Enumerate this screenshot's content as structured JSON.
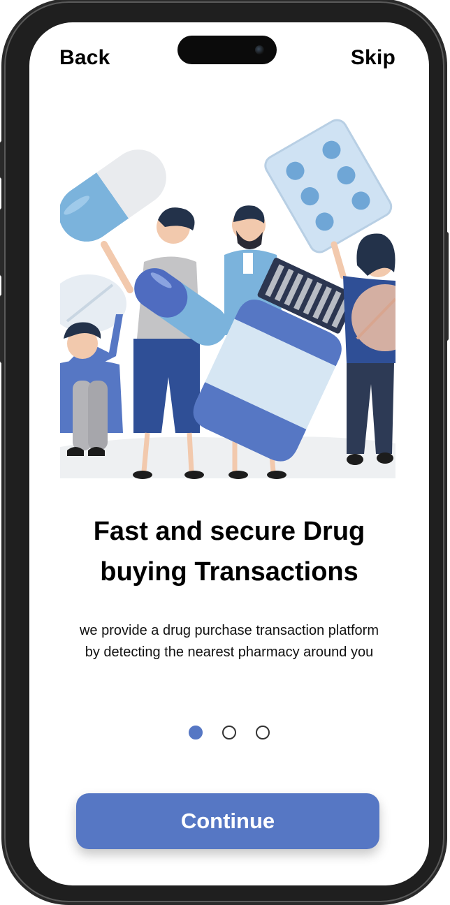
{
  "nav": {
    "back_label": "Back",
    "skip_label": "Skip"
  },
  "onboarding": {
    "title_line1": "Fast and secure Drug",
    "title_line2": "buying Transactions",
    "description": "we provide a drug purchase transaction platform by detecting the nearest pharmacy around you",
    "page_count": 3,
    "active_page": 1
  },
  "cta": {
    "label": "Continue"
  },
  "colors": {
    "accent": "#5677c4",
    "dot_inactive_border": "#333333",
    "text": "#000000",
    "phone_frame": "#1f1f1f"
  },
  "icons": [
    "camera-icon",
    "pill-icon",
    "tablet-icon",
    "blister-pack-icon",
    "medicine-bottle-icon"
  ]
}
